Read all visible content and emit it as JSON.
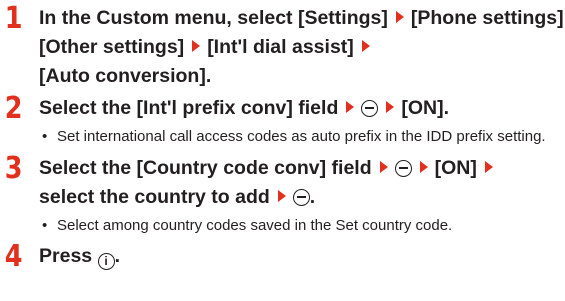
{
  "colors": {
    "accent": "#e1301e",
    "text": "#231f20"
  },
  "steps": [
    {
      "number": "1",
      "segments": [
        "In the Custom menu, select [Settings]",
        "[Phone settings]",
        "[Other settings]",
        "[Int'l dial assist]",
        "[Auto conversion]."
      ]
    },
    {
      "number": "2",
      "part1": "Select the [Int'l prefix conv] field",
      "part3": "[ON].",
      "note": "Set international call access codes as auto prefix in the IDD prefix setting."
    },
    {
      "number": "3",
      "part1": "Select the [Country code conv] field",
      "part3": "[ON]",
      "part4": "select the country to add",
      "part5": ".",
      "note": "Select among country codes saved in the Set country code."
    },
    {
      "number": "4",
      "part1": "Press",
      "part2": "."
    }
  ],
  "icons": {
    "arrow": "red-right-triangle-icon",
    "center_key": "center-key-icon",
    "menu_key": "menu-key-icon"
  }
}
